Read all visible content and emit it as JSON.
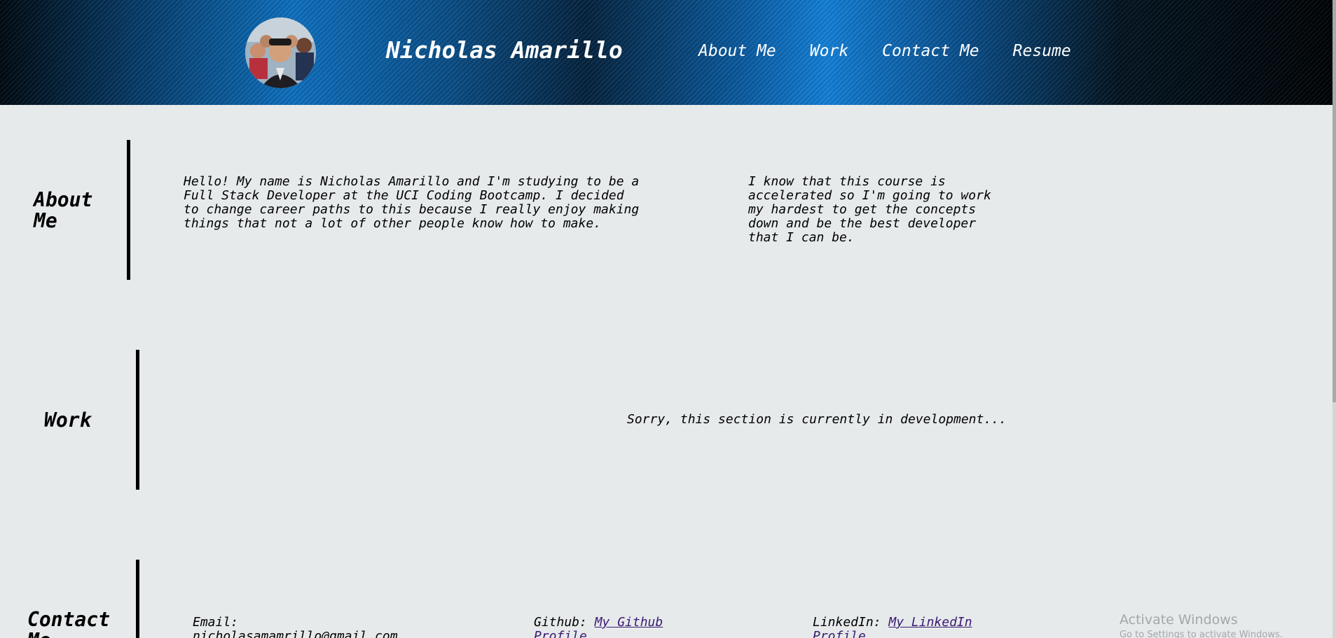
{
  "header": {
    "title": "Nicholas Amarillo",
    "avatar_alt": "profile photo",
    "nav": [
      {
        "label": "About Me"
      },
      {
        "label": "Work"
      },
      {
        "label": "Contact Me"
      },
      {
        "label": "Resume"
      }
    ]
  },
  "about": {
    "heading": "About Me",
    "paragraph1": "Hello! My name is Nicholas Amarillo and I'm studying to be a Full Stack Developer at the UCI Coding Bootcamp. I decided to change career paths to this because I really enjoy making things that not a lot of other people know how to make.",
    "paragraph2": "I know that this course is accelerated so I'm going to work my hardest to get the concepts down and be the best developer that I can be."
  },
  "work": {
    "heading": "Work",
    "message": "Sorry, this section is currently in development..."
  },
  "contact": {
    "heading": "Contact Me",
    "email_label": "Email:",
    "email_value": "nicholasamamrillo@gmail.com",
    "github_label": "Github:",
    "github_link": "My Github Profile",
    "linkedin_label": "LinkedIn:",
    "linkedin_link": "My LinkedIn Profile"
  },
  "watermark": {
    "title": "Activate Windows",
    "subtitle": "Go to Settings to activate Windows."
  }
}
